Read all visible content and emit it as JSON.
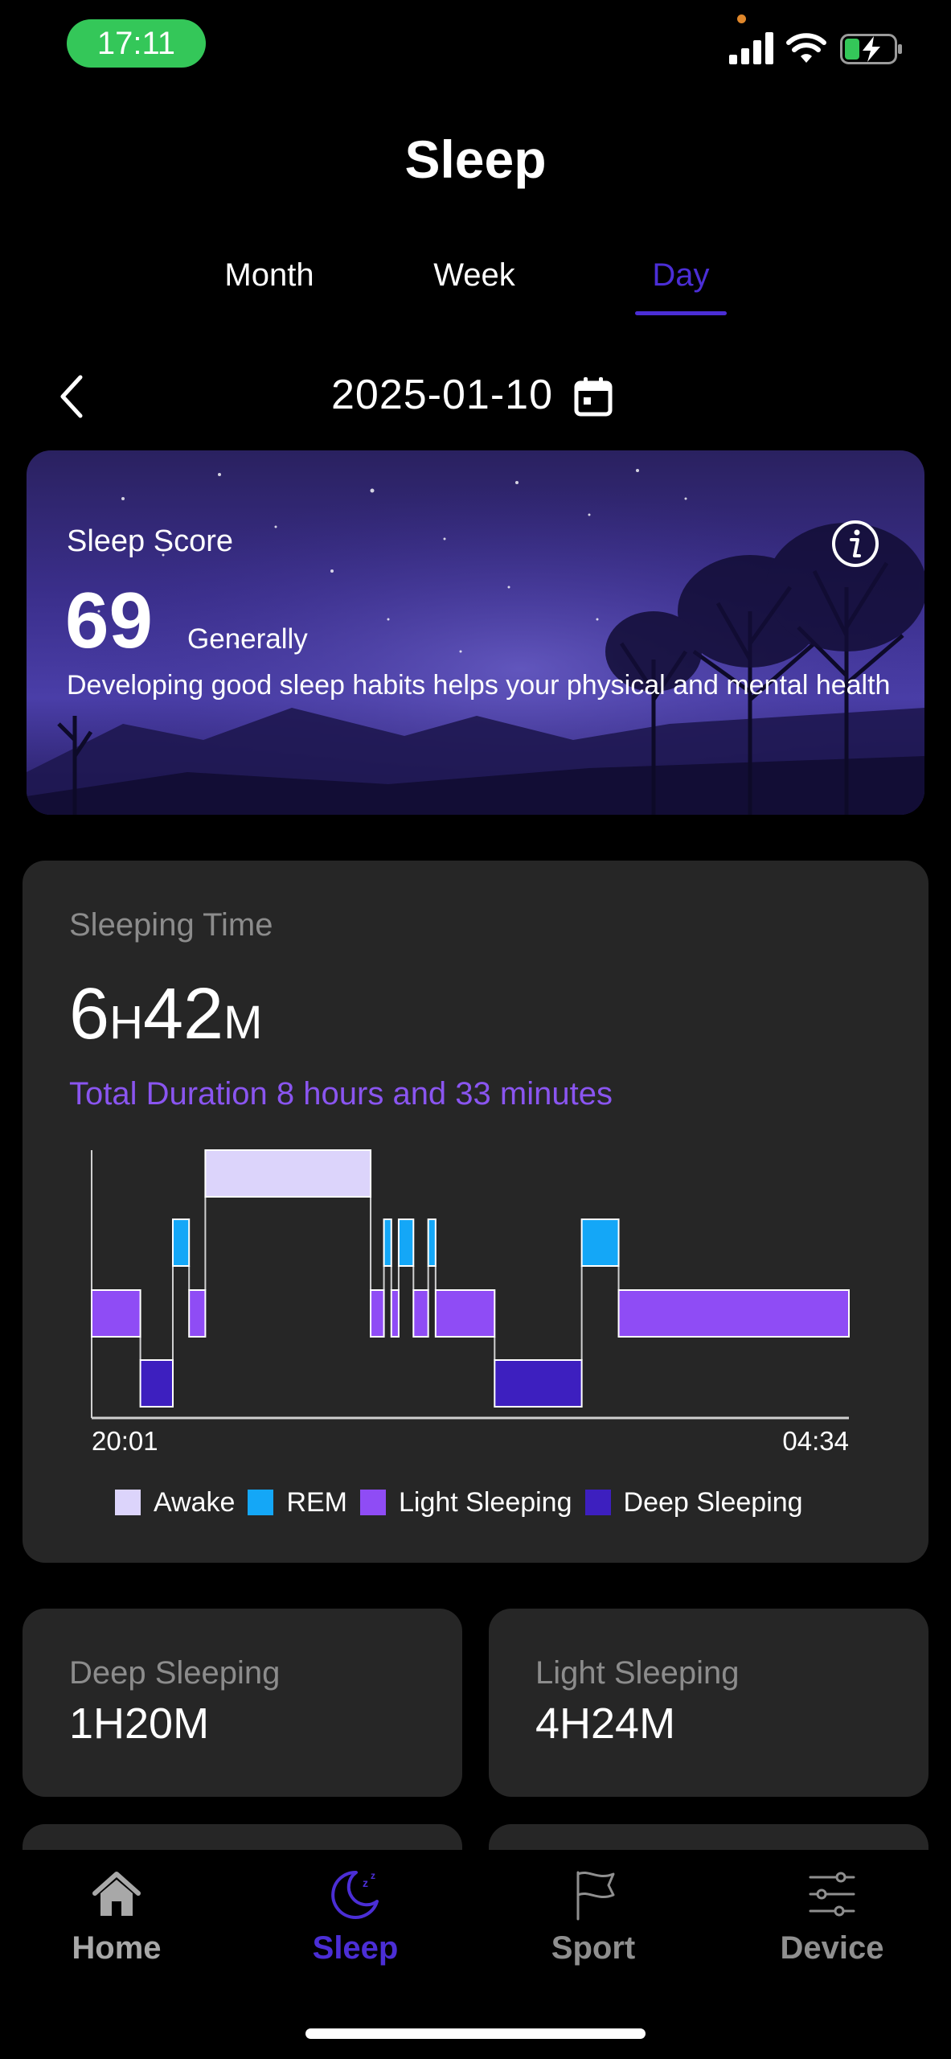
{
  "status": {
    "time": "17:11"
  },
  "header": {
    "title": "Sleep"
  },
  "tabs": [
    {
      "label": "Month",
      "active": false
    },
    {
      "label": "Week",
      "active": false
    },
    {
      "label": "Day",
      "active": true
    }
  ],
  "date": {
    "value": "2025-01-10"
  },
  "score": {
    "label": "Sleep Score",
    "value": "69",
    "rating": "Generally",
    "description": "Developing good sleep habits helps your physical and mental health"
  },
  "sleeping_time": {
    "title": "Sleeping Time",
    "hours": "6",
    "hours_unit": "H",
    "minutes": "42",
    "minutes_unit": "M",
    "total": "Total Duration 8 hours and 33 minutes",
    "start_time": "20:01",
    "end_time": "04:34"
  },
  "chart_data": {
    "type": "hypnogram",
    "x_start": "20:01",
    "x_end": "04:34",
    "x_range_minutes": [
      0,
      513
    ],
    "stages": [
      "Deep Sleeping",
      "Light Sleeping",
      "REM",
      "Awake"
    ],
    "segments": [
      {
        "stage": "Light Sleeping",
        "start": 0,
        "end": 33
      },
      {
        "stage": "Deep Sleeping",
        "start": 33,
        "end": 55
      },
      {
        "stage": "REM",
        "start": 55,
        "end": 66
      },
      {
        "stage": "Light Sleeping",
        "start": 66,
        "end": 77
      },
      {
        "stage": "Awake",
        "start": 77,
        "end": 189
      },
      {
        "stage": "Light Sleeping",
        "start": 189,
        "end": 198
      },
      {
        "stage": "REM",
        "start": 198,
        "end": 203
      },
      {
        "stage": "Light Sleeping",
        "start": 203,
        "end": 208
      },
      {
        "stage": "REM",
        "start": 208,
        "end": 218
      },
      {
        "stage": "Light Sleeping",
        "start": 218,
        "end": 228
      },
      {
        "stage": "REM",
        "start": 228,
        "end": 233
      },
      {
        "stage": "Light Sleeping",
        "start": 233,
        "end": 273
      },
      {
        "stage": "Deep Sleeping",
        "start": 273,
        "end": 332
      },
      {
        "stage": "REM",
        "start": 332,
        "end": 357
      },
      {
        "stage": "Light Sleeping",
        "start": 357,
        "end": 513
      }
    ],
    "legend": [
      {
        "label": "Awake",
        "color": "#dcd4fb"
      },
      {
        "label": "REM",
        "color": "#14a7f7"
      },
      {
        "label": "Light Sleeping",
        "color": "#8f4cf5"
      },
      {
        "label": "Deep Sleeping",
        "color": "#3d1fbf"
      }
    ]
  },
  "stats": {
    "deep": {
      "label": "Deep Sleeping",
      "value": "1H20M"
    },
    "light": {
      "label": "Light Sleeping",
      "value": "4H24M"
    }
  },
  "nav": [
    {
      "label": "Home",
      "icon": "home-icon"
    },
    {
      "label": "Sleep",
      "icon": "moon-icon",
      "active": true
    },
    {
      "label": "Sport",
      "icon": "flag-icon"
    },
    {
      "label": "Device",
      "icon": "sliders-icon"
    }
  ],
  "colors": {
    "accent": "#4b2ed6",
    "card": "#262626",
    "status_green": "#34c759"
  }
}
